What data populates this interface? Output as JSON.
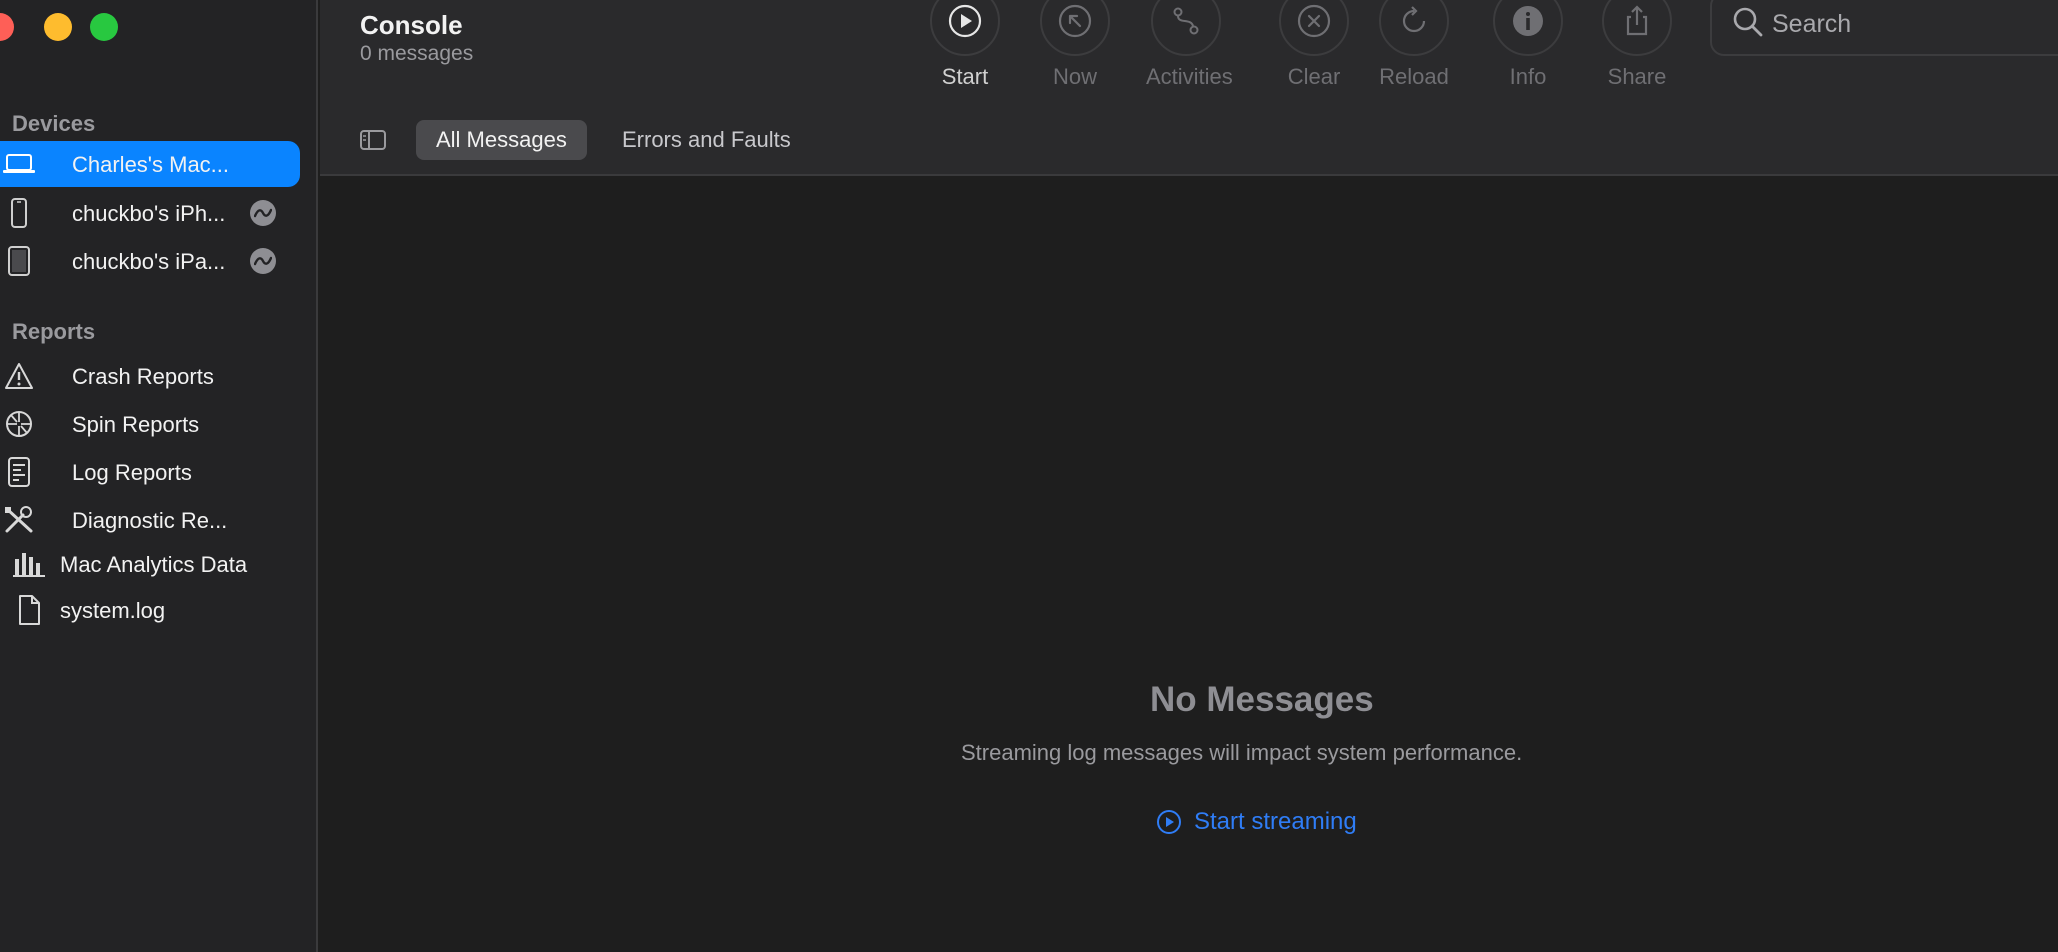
{
  "window": {
    "title": "Console",
    "message_count": "0 messages"
  },
  "sidebar": {
    "devices_header": "Devices",
    "devices": [
      {
        "label": "Charles's Mac...",
        "icon": "laptop-icon",
        "selected": true
      },
      {
        "label": "chuckbo's iPh...",
        "icon": "iphone-icon",
        "streaming_badge": true
      },
      {
        "label": "chuckbo's iPa...",
        "icon": "ipad-icon",
        "streaming_badge": true
      }
    ],
    "reports_header": "Reports",
    "reports": [
      {
        "label": "Crash Reports",
        "icon": "warning-icon"
      },
      {
        "label": "Spin Reports",
        "icon": "spin-icon"
      },
      {
        "label": "Log Reports",
        "icon": "log-icon"
      },
      {
        "label": "Diagnostic Re...",
        "icon": "tools-icon"
      },
      {
        "label": "Mac Analytics Data",
        "icon": "bar-chart-icon"
      },
      {
        "label": "system.log",
        "icon": "document-icon"
      }
    ]
  },
  "toolbar": {
    "buttons": [
      {
        "label": "Start",
        "icon": "play-icon",
        "enabled": true
      },
      {
        "label": "Now",
        "icon": "arrow-up-left-icon",
        "enabled": false
      },
      {
        "label": "Activities",
        "icon": "activities-icon",
        "enabled": false
      },
      {
        "label": "Clear",
        "icon": "clear-icon",
        "enabled": false
      },
      {
        "label": "Reload",
        "icon": "reload-icon",
        "enabled": false
      },
      {
        "label": "Info",
        "icon": "info-icon",
        "enabled": false
      },
      {
        "label": "Share",
        "icon": "share-icon",
        "enabled": false
      }
    ],
    "search": {
      "placeholder": "Search",
      "value": ""
    }
  },
  "tabs": [
    {
      "label": "All Messages",
      "selected": true
    },
    {
      "label": "Errors and Faults",
      "selected": false
    }
  ],
  "main": {
    "empty_title": "No Messages",
    "empty_subtitle": "Streaming log messages will impact system performance.",
    "start_streaming_label": "Start streaming"
  },
  "colors": {
    "accent": "#0a84ff",
    "link": "#2f7df6",
    "sidebar_bg": "#232325",
    "main_bg": "#1e1e1e",
    "toolbar_bg": "#2a2a2c"
  }
}
